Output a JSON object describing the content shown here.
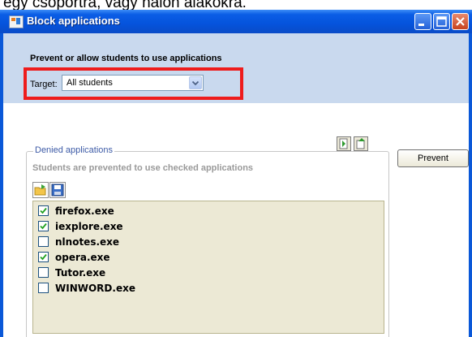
{
  "top_text": "egy csoportra, vagy nálon alakokra.",
  "window": {
    "title": "Block applications"
  },
  "header": {
    "subtitle": "Prevent or allow students to use applications",
    "target_label": "Target:",
    "target_value": "All students"
  },
  "toolbar": {
    "import_icon": "import-arrow-icon",
    "export_icon": "export-arrow-icon"
  },
  "prevent_button": "Prevent",
  "denied": {
    "legend": "Denied applications",
    "description": "Students are prevented to use checked applications",
    "open_icon": "open-folder-icon",
    "save_icon": "save-disk-icon",
    "items": [
      {
        "label": "firefox.exe",
        "checked": true
      },
      {
        "label": "iexplore.exe",
        "checked": true
      },
      {
        "label": "nlnotes.exe",
        "checked": false
      },
      {
        "label": "opera.exe",
        "checked": true
      },
      {
        "label": "Tutor.exe",
        "checked": false
      },
      {
        "label": "WINWORD.exe",
        "checked": false
      }
    ]
  },
  "colors": {
    "titlebar": "#0553dc",
    "header_band": "#c9d9ee",
    "highlight": "#ee1c1c",
    "list_background": "#ece9d5"
  }
}
